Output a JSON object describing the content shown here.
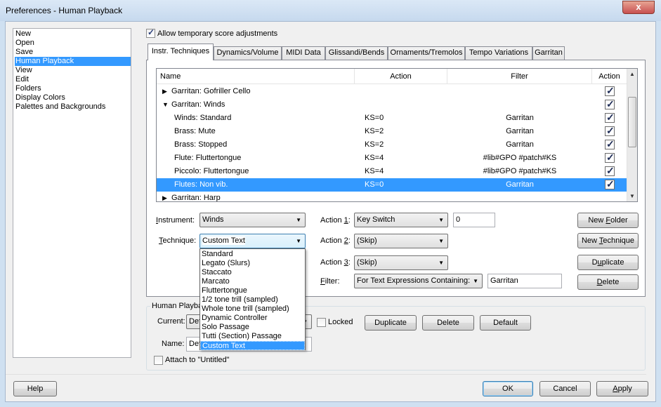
{
  "window": {
    "title": "Preferences - Human Playback",
    "close_glyph": "x"
  },
  "categories": [
    {
      "label": "New"
    },
    {
      "label": "Open"
    },
    {
      "label": "Save"
    },
    {
      "label": "Human Playback",
      "selected": true
    },
    {
      "label": "View"
    },
    {
      "label": "Edit"
    },
    {
      "label": "Folders"
    },
    {
      "label": "Display Colors"
    },
    {
      "label": "Palettes and Backgrounds"
    }
  ],
  "allow_temp": {
    "label": "Allow temporary score adjustments",
    "checked": true
  },
  "tabs": [
    {
      "label": "Instr. Techniques",
      "active": true
    },
    {
      "label": "Dynamics/Volume"
    },
    {
      "label": "MIDI Data"
    },
    {
      "label": "Glissandi/Bends"
    },
    {
      "label": "Ornaments/Tremolos"
    },
    {
      "label": "Tempo Variations"
    },
    {
      "label": "Garritan"
    }
  ],
  "table": {
    "headers": [
      "Name",
      "Action",
      "Filter",
      "Action"
    ],
    "rows": [
      {
        "expander": "▶",
        "name": "Garritan: Gofriller Cello",
        "action": "",
        "filter": "",
        "checked": true
      },
      {
        "expander": "▼",
        "name": "Garritan: Winds",
        "action": "",
        "filter": "",
        "checked": true
      },
      {
        "expander": "",
        "name": "Winds: Standard",
        "action": "KS=0",
        "filter": "Garritan",
        "checked": true
      },
      {
        "expander": "",
        "name": "Brass: Mute",
        "action": "KS=2",
        "filter": "Garritan",
        "checked": true
      },
      {
        "expander": "",
        "name": "Brass: Stopped",
        "action": "KS=2",
        "filter": "Garritan",
        "checked": true
      },
      {
        "expander": "",
        "name": "Flute: Fluttertongue",
        "action": "KS=4",
        "filter": "#lib#GPO #patch#KS",
        "checked": true
      },
      {
        "expander": "",
        "name": "Piccolo: Fluttertongue",
        "action": "KS=4",
        "filter": "#lib#GPO #patch#KS",
        "checked": true
      },
      {
        "expander": "",
        "name": "Flutes: Non vib.",
        "action": "KS=0",
        "filter": "Garritan",
        "checked": true,
        "selected": true
      },
      {
        "expander": "▶",
        "name": "Garritan: Harp",
        "action": "",
        "filter": "",
        "checked": false
      }
    ]
  },
  "form": {
    "instrument_label_u": "I",
    "instrument_label_rest": "nstrument:",
    "instrument_value": "Winds",
    "technique_label_u": "T",
    "technique_label_rest": "echnique:",
    "technique_value": "Custom Text",
    "action1_label_pre": "Action ",
    "action1_label_u": "1",
    "action1_label_post": ":",
    "action1_value": "Key Switch",
    "action1_param": "0",
    "action2_label_pre": "Action ",
    "action2_label_u": "2",
    "action2_label_post": ":",
    "action2_value": "(Skip)",
    "action3_label_pre": "Action ",
    "action3_label_u": "3",
    "action3_label_post": ":",
    "action3_value": "(Skip)",
    "filter_label_u": "F",
    "filter_label_rest": "ilter:",
    "filter_value": "For Text Expressions Containing:",
    "filter_text": "Garritan"
  },
  "side_buttons": {
    "new_folder_pre": "New ",
    "new_folder_u": "F",
    "new_folder_post": "older",
    "new_technique_pre": "New ",
    "new_technique_u": "T",
    "new_technique_post": "echnique",
    "duplicate_pre": "D",
    "duplicate_u": "u",
    "duplicate_post": "plicate",
    "delete_u": "D",
    "delete_rest": "elete"
  },
  "technique_options": [
    "Standard",
    "Legato (Slurs)",
    "Staccato",
    "Marcato",
    "Fluttertongue",
    "1/2 tone trill (sampled)",
    "Whole tone trill (sampled)",
    "Dynamic Controller",
    "Solo Passage",
    "Tutti (Section) Passage",
    "Custom Text"
  ],
  "playback_group": {
    "title": "Human Playba",
    "current_label": "Current:",
    "current_value": "Def",
    "locked_label": "Locked",
    "duplicate": "Duplicate",
    "delete": "Delete",
    "default": "Default",
    "name_label": "Name:",
    "name_value": "Def",
    "attach_label": "Attach to \"Untitled\""
  },
  "footer": {
    "help": "Help",
    "ok": "OK",
    "cancel": "Cancel",
    "apply_u": "A",
    "apply_rest": "pply"
  }
}
